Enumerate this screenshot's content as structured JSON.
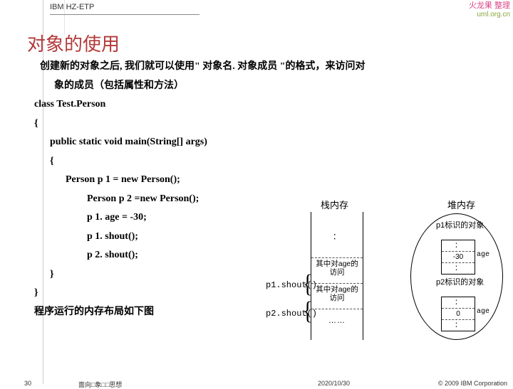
{
  "header": {
    "project": "IBM HZ-ETP"
  },
  "watermark": {
    "line1": "火龙果   整理",
    "line2": "uml.org.cn"
  },
  "title": "对象的使用",
  "intro": {
    "line1": "创建新的对象之后, 我们就可以使用\" 对象名. 对象成员 \"的格式，来访问对",
    "line2": "象的成员（包括属性和方法）"
  },
  "code": {
    "c1": "class Test.Person",
    "c2": "{",
    "c3": "public static void main(String[] args)",
    "c4": "{",
    "c5": "Person p 1 = new Person();",
    "c6": "Person p 2 =new Person();",
    "c7": "p 1. age = -30;",
    "c8": "p 1. shout();",
    "c9": "p 2. shout();",
    "c10": "}",
    "c11": "}",
    "post": "程序运行的内存布局如下图"
  },
  "diagram": {
    "stack_label": "栈内存",
    "heap_label": "堆内存",
    "p1_call": "p1.shout()",
    "p2_call": "p2.shout()",
    "cell_text1": "其中对age的访问",
    "cell_text2": "其中对age的访问",
    "obj1_label": "p1标识的对象",
    "obj2_label": "p2标识的对象",
    "obj1_value": "-30",
    "obj2_value": "0",
    "age": "age",
    "dots": "：",
    "ellipsis": "……"
  },
  "footer": {
    "page": "30",
    "mid": "面向□象□□思想",
    "date": "2020/10/30",
    "right": "© 2009 IBM Corporation"
  }
}
